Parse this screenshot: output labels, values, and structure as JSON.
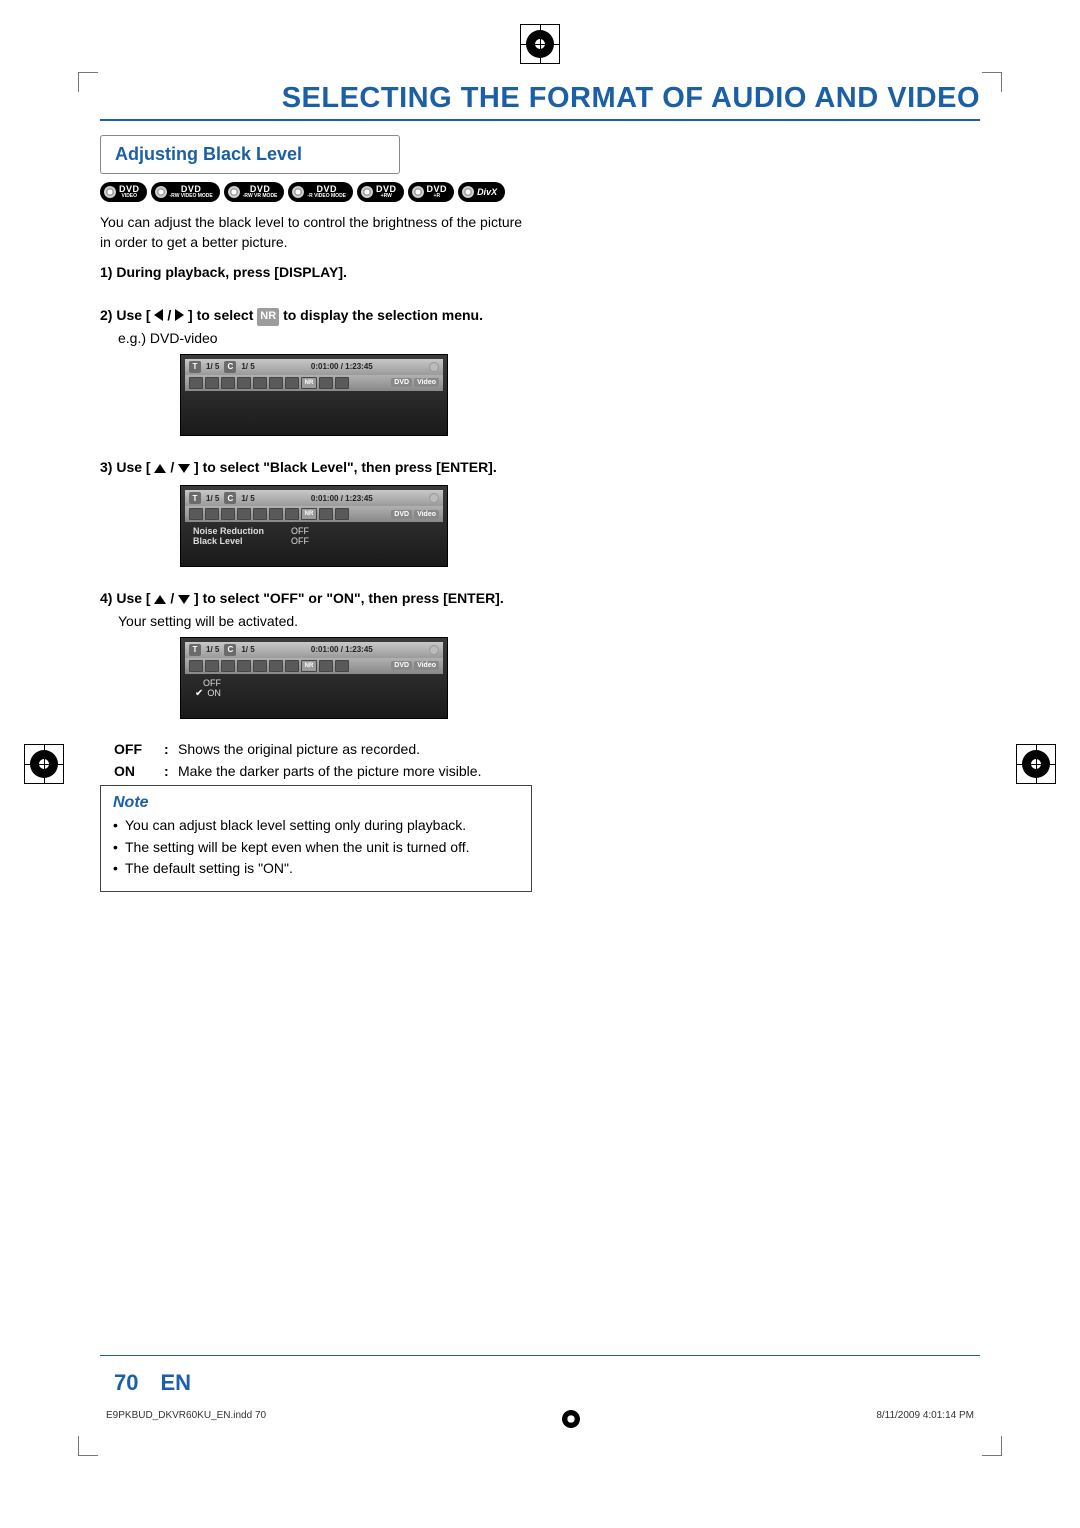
{
  "header": {
    "title": "SELECTING THE FORMAT OF AUDIO AND VIDEO"
  },
  "section": {
    "title": "Adjusting Black Level"
  },
  "badges": [
    {
      "top": "DVD",
      "bottom": "VIDEO"
    },
    {
      "top": "DVD",
      "bottom": "-RW VIDEO MODE"
    },
    {
      "top": "DVD",
      "bottom": "-RW VR MODE"
    },
    {
      "top": "DVD",
      "bottom": "-R VIDEO MODE"
    },
    {
      "top": "DVD",
      "bottom": "+RW"
    },
    {
      "top": "DVD",
      "bottom": "+R"
    },
    {
      "top": "DivX",
      "bottom": ""
    }
  ],
  "intro": "You can adjust the black level to control the brightness of the picture in order to get a better picture.",
  "steps": {
    "s1": "1) During playback, press [DISPLAY].",
    "s2a": "2) Use [",
    "s2b": "] to select ",
    "s2c": " to display the selection menu.",
    "nr_badge": "NR",
    "eg": "e.g.) DVD-video",
    "s3": "3) Use [",
    "s3b": "] to select \"Black Level\", then press [ENTER].",
    "s4": "4) Use [",
    "s4b": "] to select \"OFF\" or \"ON\", then press [ENTER].",
    "s4sub": "Your setting will be activated."
  },
  "osd": {
    "t_label": "T",
    "c_label": "C",
    "track1": "1/   5",
    "track2": "1/   5",
    "time": "0:01:00 / 1:23:45",
    "disc_tag1": "DVD",
    "disc_tag2": "Video",
    "nr": "NR",
    "menu": {
      "noise": {
        "label": "Noise Reduction",
        "value": "OFF"
      },
      "black": {
        "label": "Black Level",
        "value": "OFF"
      }
    },
    "opts": {
      "off": "OFF",
      "on": "ON"
    }
  },
  "defs": {
    "off": {
      "k": "OFF",
      "v": "Shows the original picture as recorded."
    },
    "on": {
      "k": "ON",
      "v": "Make the darker parts of the picture more visible."
    }
  },
  "note": {
    "heading": "Note",
    "items": [
      "You can adjust black level setting only during playback.",
      "The setting will be kept even when the unit is turned off.",
      "The default setting is \"ON\"."
    ]
  },
  "footer": {
    "page": "70",
    "lang": "EN",
    "file": "E9PKBUD_DKVR60KU_EN.indd   70",
    "timestamp": "8/11/2009   4:01:14 PM"
  }
}
